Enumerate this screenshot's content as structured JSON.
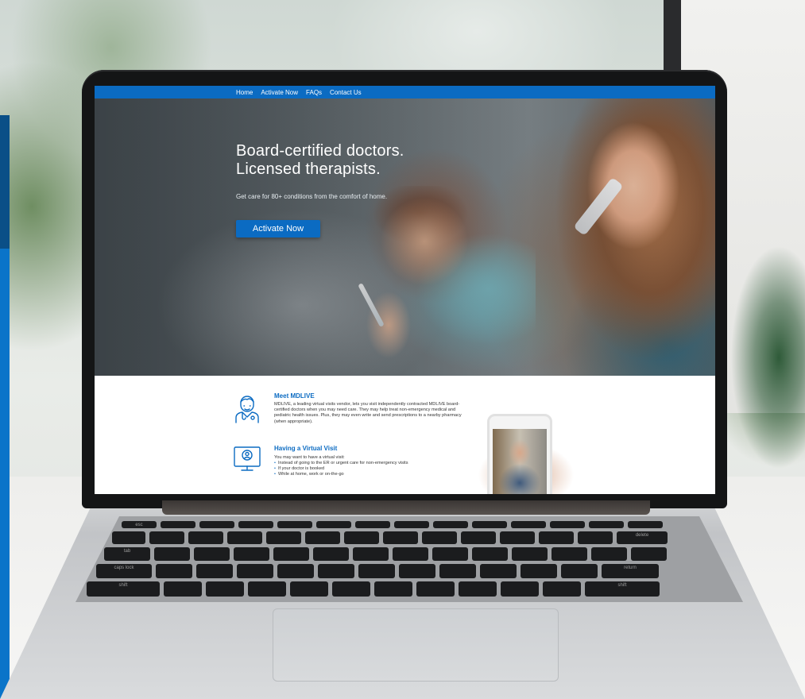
{
  "nav": {
    "items": [
      "Home",
      "Activate Now",
      "FAQs",
      "Contact Us"
    ]
  },
  "hero": {
    "title_line1": "Board-certified doctors.",
    "title_line2": "Licensed therapists.",
    "subtitle": "Get care for 80+ conditions from the comfort of home.",
    "cta_label": "Activate Now"
  },
  "info": {
    "meet": {
      "heading": "Meet MDLIVE",
      "body": "MDLIVE, a leading virtual visits vendor, lets you visit independently contracted MDLIVE board-certified doctors when you may need care. They may help treat non-emergency medical and pediatric health issues. Plus, they may even write and send prescriptions to a nearby pharmacy (when appropriate)."
    },
    "visit": {
      "heading": "Having a Virtual Visit",
      "intro": "You may want to have a virtual visit:",
      "bullets": [
        "Instead of going to the ER or urgent care for non-emergency visits",
        "If your doctor is booked",
        "While at home, work or on-the-go"
      ]
    }
  },
  "keyboard": {
    "row1": [
      "esc",
      "",
      "",
      "",
      "",
      "",
      "",
      "",
      "",
      "",
      "",
      "",
      "",
      ""
    ],
    "row_labels": {
      "tab": "tab",
      "caps": "caps lock",
      "shift": "shift",
      "delete": "delete",
      "return": "return"
    }
  },
  "colors": {
    "brand_blue": "#0b6bc2",
    "text_dark": "#333333"
  }
}
